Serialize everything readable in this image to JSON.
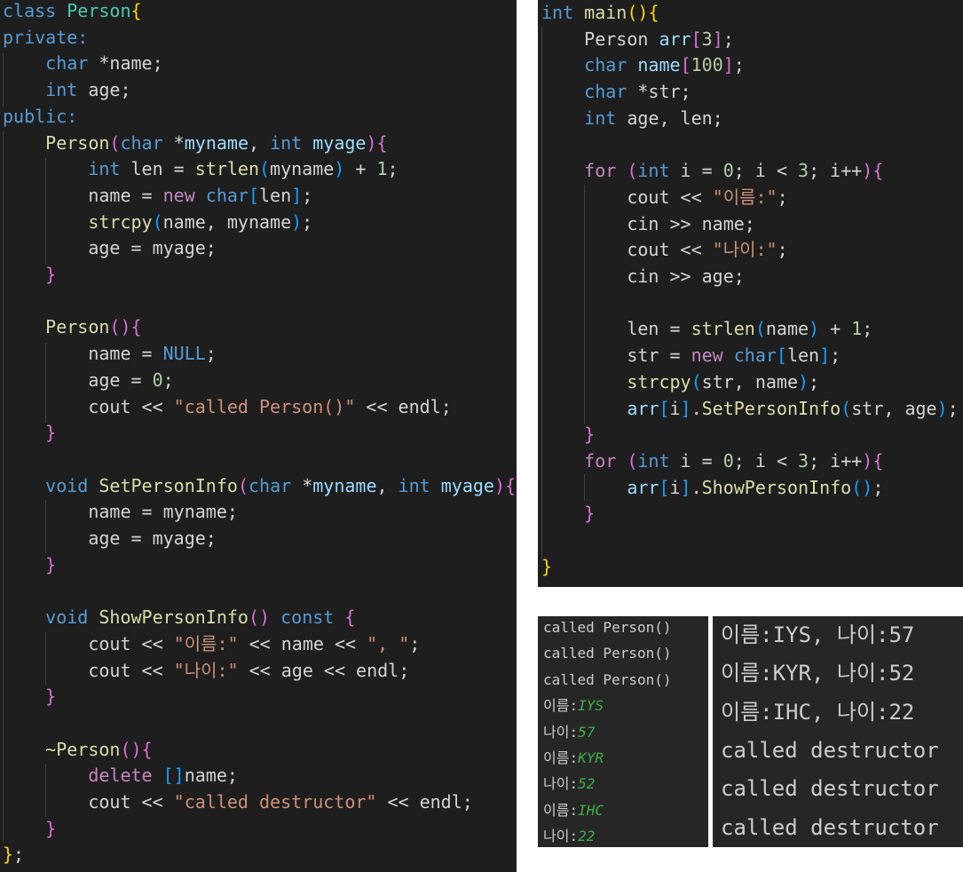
{
  "left_editor": {
    "lines": [
      [
        [
          "class ",
          "kw"
        ],
        [
          "Person",
          "typ"
        ],
        [
          "{",
          "b1"
        ]
      ],
      [
        [
          "private:",
          "kw"
        ]
      ],
      [
        [
          "    "
        ],
        [
          "char",
          "kw"
        ],
        [
          " *name;",
          "op"
        ]
      ],
      [
        [
          "    "
        ],
        [
          "int",
          "kw"
        ],
        [
          " age;",
          "op"
        ]
      ],
      [
        [
          "public:",
          "kw"
        ]
      ],
      [
        [
          "    "
        ],
        [
          "Person",
          "fn"
        ],
        [
          "(",
          "b2"
        ],
        [
          "char",
          "kw"
        ],
        [
          " *",
          "op"
        ],
        [
          "myname",
          "var"
        ],
        [
          ", ",
          "op"
        ],
        [
          "int",
          "kw"
        ],
        [
          " ",
          "op"
        ],
        [
          "myage",
          "var"
        ],
        [
          ")",
          "b2"
        ],
        [
          "{",
          "b2"
        ]
      ],
      [
        [
          "        "
        ],
        [
          "int",
          "kw"
        ],
        [
          " len = ",
          "op"
        ],
        [
          "strlen",
          "fn"
        ],
        [
          "(",
          "b3"
        ],
        [
          "myname",
          "op"
        ],
        [
          ")",
          "b3"
        ],
        [
          " + ",
          "op"
        ],
        [
          "1",
          "num"
        ],
        [
          ";",
          "op"
        ]
      ],
      [
        [
          "        name = ",
          "op"
        ],
        [
          "new",
          "ctl"
        ],
        [
          " ",
          "op"
        ],
        [
          "char",
          "kw"
        ],
        [
          "[",
          "b3"
        ],
        [
          "len",
          "op"
        ],
        [
          "]",
          "b3"
        ],
        [
          ";",
          "op"
        ]
      ],
      [
        [
          "        "
        ],
        [
          "strcpy",
          "fn"
        ],
        [
          "(",
          "b3"
        ],
        [
          "name, myname",
          "op"
        ],
        [
          ")",
          "b3"
        ],
        [
          ";",
          "op"
        ]
      ],
      [
        [
          "        age = myage;",
          "op"
        ]
      ],
      [
        [
          "    "
        ],
        [
          "}",
          "b2"
        ]
      ],
      [
        [
          ""
        ]
      ],
      [
        [
          "    "
        ],
        [
          "Person",
          "fn"
        ],
        [
          "(){",
          "b2"
        ]
      ],
      [
        [
          "        name = ",
          "op"
        ],
        [
          "NULL",
          "kw"
        ],
        [
          ";",
          "op"
        ]
      ],
      [
        [
          "        age = ",
          "op"
        ],
        [
          "0",
          "num"
        ],
        [
          ";",
          "op"
        ]
      ],
      [
        [
          "        cout << ",
          "op"
        ],
        [
          "\"called Person()\"",
          "str"
        ],
        [
          " << endl;",
          "op"
        ]
      ],
      [
        [
          "    "
        ],
        [
          "}",
          "b2"
        ]
      ],
      [
        [
          ""
        ]
      ],
      [
        [
          "    "
        ],
        [
          "void",
          "kw"
        ],
        [
          " ",
          "op"
        ],
        [
          "SetPersonInfo",
          "fn"
        ],
        [
          "(",
          "b2"
        ],
        [
          "char",
          "kw"
        ],
        [
          " *",
          "op"
        ],
        [
          "myname",
          "var"
        ],
        [
          ", ",
          "op"
        ],
        [
          "int",
          "kw"
        ],
        [
          " ",
          "op"
        ],
        [
          "myage",
          "var"
        ],
        [
          ")",
          "b2"
        ],
        [
          "{",
          "b2"
        ]
      ],
      [
        [
          "        name = myname;",
          "op"
        ]
      ],
      [
        [
          "        age = myage;",
          "op"
        ]
      ],
      [
        [
          "    "
        ],
        [
          "}",
          "b2"
        ]
      ],
      [
        [
          ""
        ]
      ],
      [
        [
          "    "
        ],
        [
          "void",
          "kw"
        ],
        [
          " ",
          "op"
        ],
        [
          "ShowPersonInfo",
          "fn"
        ],
        [
          "()",
          "b2"
        ],
        [
          " ",
          "op"
        ],
        [
          "const",
          "kw"
        ],
        [
          " ",
          "op"
        ],
        [
          "{",
          "b2"
        ]
      ],
      [
        [
          "        cout << ",
          "op"
        ],
        [
          "\"이름:\"",
          "str"
        ],
        [
          " << name << ",
          "op"
        ],
        [
          "\", \"",
          "str"
        ],
        [
          ";",
          "op"
        ]
      ],
      [
        [
          "        cout << ",
          "op"
        ],
        [
          "\"나이:\"",
          "str"
        ],
        [
          " << age << endl;",
          "op"
        ]
      ],
      [
        [
          "    "
        ],
        [
          "}",
          "b2"
        ]
      ],
      [
        [
          ""
        ]
      ],
      [
        [
          "    "
        ],
        [
          "~Person",
          "fn"
        ],
        [
          "(){",
          "b2"
        ]
      ],
      [
        [
          "        "
        ],
        [
          "delete",
          "ctl"
        ],
        [
          " ",
          "op"
        ],
        [
          "[]",
          "b3"
        ],
        [
          "name;",
          "op"
        ]
      ],
      [
        [
          "        cout << ",
          "op"
        ],
        [
          "\"called destructor\"",
          "str"
        ],
        [
          " << endl;",
          "op"
        ]
      ],
      [
        [
          "    "
        ],
        [
          "}",
          "b2"
        ]
      ],
      [
        [
          "}",
          "b1"
        ],
        [
          ";",
          "op"
        ]
      ]
    ]
  },
  "right_editor": {
    "lines": [
      [
        [
          "int",
          "kw"
        ],
        [
          " ",
          "op"
        ],
        [
          "main",
          "fn"
        ],
        [
          "()",
          "b1"
        ],
        [
          "{",
          "b1"
        ]
      ],
      [
        [
          "    "
        ],
        [
          "Person",
          "op"
        ],
        [
          " ",
          "op"
        ],
        [
          "arr",
          "var"
        ],
        [
          "[",
          "b2"
        ],
        [
          "3",
          "num"
        ],
        [
          "]",
          "b2"
        ],
        [
          ";",
          "op"
        ]
      ],
      [
        [
          "    "
        ],
        [
          "char",
          "kw"
        ],
        [
          " ",
          "op"
        ],
        [
          "name",
          "var"
        ],
        [
          "[",
          "b2"
        ],
        [
          "100",
          "num"
        ],
        [
          "]",
          "b2"
        ],
        [
          ";",
          "op"
        ]
      ],
      [
        [
          "    "
        ],
        [
          "char",
          "kw"
        ],
        [
          " *str;",
          "op"
        ]
      ],
      [
        [
          "    "
        ],
        [
          "int",
          "kw"
        ],
        [
          " age, len;",
          "op"
        ]
      ],
      [
        [
          ""
        ]
      ],
      [
        [
          "    "
        ],
        [
          "for",
          "ctl"
        ],
        [
          " ",
          "op"
        ],
        [
          "(",
          "b2"
        ],
        [
          "int",
          "kw"
        ],
        [
          " i = ",
          "op"
        ],
        [
          "0",
          "num"
        ],
        [
          "; i < ",
          "op"
        ],
        [
          "3",
          "num"
        ],
        [
          "; i++",
          "op"
        ],
        [
          ")",
          "b2"
        ],
        [
          "{",
          "b2"
        ]
      ],
      [
        [
          "        cout << ",
          "op"
        ],
        [
          "\"이름:\"",
          "str"
        ],
        [
          ";",
          "op"
        ]
      ],
      [
        [
          "        cin >> name;",
          "op"
        ]
      ],
      [
        [
          "        cout << ",
          "op"
        ],
        [
          "\"나이:\"",
          "str"
        ],
        [
          ";",
          "op"
        ]
      ],
      [
        [
          "        cin >> age;",
          "op"
        ]
      ],
      [
        [
          ""
        ]
      ],
      [
        [
          "        len = ",
          "op"
        ],
        [
          "strlen",
          "fn"
        ],
        [
          "(",
          "b3"
        ],
        [
          "name",
          "op"
        ],
        [
          ")",
          "b3"
        ],
        [
          " + ",
          "op"
        ],
        [
          "1",
          "num"
        ],
        [
          ";",
          "op"
        ]
      ],
      [
        [
          "        str = ",
          "op"
        ],
        [
          "new",
          "ctl"
        ],
        [
          " ",
          "op"
        ],
        [
          "char",
          "kw"
        ],
        [
          "[",
          "b3"
        ],
        [
          "len",
          "op"
        ],
        [
          "]",
          "b3"
        ],
        [
          ";",
          "op"
        ]
      ],
      [
        [
          "        "
        ],
        [
          "strcpy",
          "fn"
        ],
        [
          "(",
          "b3"
        ],
        [
          "str, name",
          "op"
        ],
        [
          ")",
          "b3"
        ],
        [
          ";",
          "op"
        ]
      ],
      [
        [
          "        "
        ],
        [
          "arr",
          "var"
        ],
        [
          "[",
          "b3"
        ],
        [
          "i",
          "op"
        ],
        [
          "]",
          "b3"
        ],
        [
          ".",
          "op"
        ],
        [
          "SetPersonInfo",
          "fn"
        ],
        [
          "(",
          "b3"
        ],
        [
          "str, age",
          "op"
        ],
        [
          ")",
          "b3"
        ],
        [
          ";",
          "op"
        ]
      ],
      [
        [
          "    "
        ],
        [
          "}",
          "b2"
        ]
      ],
      [
        [
          "    "
        ],
        [
          "for",
          "ctl"
        ],
        [
          " ",
          "op"
        ],
        [
          "(",
          "b2"
        ],
        [
          "int",
          "kw"
        ],
        [
          " i = ",
          "op"
        ],
        [
          "0",
          "num"
        ],
        [
          "; i < ",
          "op"
        ],
        [
          "3",
          "num"
        ],
        [
          "; i++",
          "op"
        ],
        [
          ")",
          "b2"
        ],
        [
          "{",
          "b2"
        ]
      ],
      [
        [
          "        "
        ],
        [
          "arr",
          "var"
        ],
        [
          "[",
          "b3"
        ],
        [
          "i",
          "op"
        ],
        [
          "]",
          "b3"
        ],
        [
          ".",
          "op"
        ],
        [
          "ShowPersonInfo",
          "fn"
        ],
        [
          "()",
          "b3"
        ],
        [
          ";",
          "op"
        ]
      ],
      [
        [
          "    "
        ],
        [
          "}",
          "b2"
        ]
      ],
      [
        [
          ""
        ]
      ],
      [
        [
          "}",
          "b1"
        ]
      ]
    ]
  },
  "console_input": {
    "lines": [
      [
        [
          "called Person()"
        ]
      ],
      [
        [
          "called Person()"
        ]
      ],
      [
        [
          "called Person()"
        ]
      ],
      [
        [
          "이름:"
        ],
        [
          "IYS",
          "g"
        ]
      ],
      [
        [
          "나이:"
        ],
        [
          "57",
          "g"
        ]
      ],
      [
        [
          "이름:"
        ],
        [
          "KYR",
          "g"
        ]
      ],
      [
        [
          "나이:"
        ],
        [
          "52",
          "g"
        ]
      ],
      [
        [
          "이름:"
        ],
        [
          "IHC",
          "g"
        ]
      ],
      [
        [
          "나이:"
        ],
        [
          "22",
          "g"
        ]
      ]
    ]
  },
  "console_output": {
    "lines": [
      [
        [
          "이름:IYS, 나이:57"
        ]
      ],
      [
        [
          "이름:KYR, 나이:52"
        ]
      ],
      [
        [
          "이름:IHC, 나이:22"
        ]
      ],
      [
        [
          "called destructor"
        ]
      ],
      [
        [
          "called destructor"
        ]
      ],
      [
        [
          "called destructor"
        ]
      ]
    ]
  }
}
